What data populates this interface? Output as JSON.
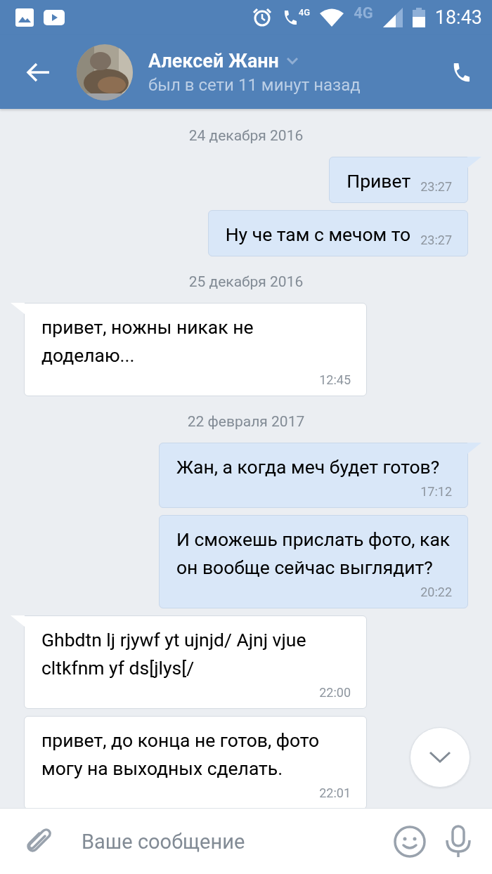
{
  "status_bar": {
    "call_badge": "4G",
    "network": "4G",
    "time": "18:43"
  },
  "header": {
    "name": "Алексей Жанн",
    "status": "был в сети 11 минут назад"
  },
  "messages": [
    {
      "kind": "date",
      "text": "24 декабря 2016"
    },
    {
      "kind": "message",
      "outgoing": true,
      "tail": true,
      "text": "Привет",
      "time": "23:27"
    },
    {
      "kind": "message",
      "outgoing": true,
      "tail": false,
      "text": "Ну че там с мечом то",
      "time": "23:27"
    },
    {
      "kind": "date",
      "text": "25 декабря 2016"
    },
    {
      "kind": "message",
      "outgoing": false,
      "tail": true,
      "text": "привет, ножны никак не доделаю...",
      "time": "12:45"
    },
    {
      "kind": "date",
      "text": "22 февраля 2017"
    },
    {
      "kind": "message",
      "outgoing": true,
      "tail": true,
      "text": "Жан, а когда меч будет готов?",
      "time": "17:12"
    },
    {
      "kind": "message",
      "outgoing": true,
      "tail": false,
      "text": "И сможешь прислать фото, как он вообще сейчас выглядит?",
      "time": "20:22"
    },
    {
      "kind": "message",
      "outgoing": false,
      "tail": true,
      "text": "Ghbdtn lj rjywf yt ujnjd/ Ajnj vjue cltkfnm yf ds[jlys[/",
      "time": "22:00"
    },
    {
      "kind": "message",
      "outgoing": false,
      "tail": false,
      "text": "привет, до конца не готов, фото могу на выходных сделать.",
      "time": "22:01"
    }
  ],
  "composer": {
    "placeholder": "Ваше сообщение"
  }
}
